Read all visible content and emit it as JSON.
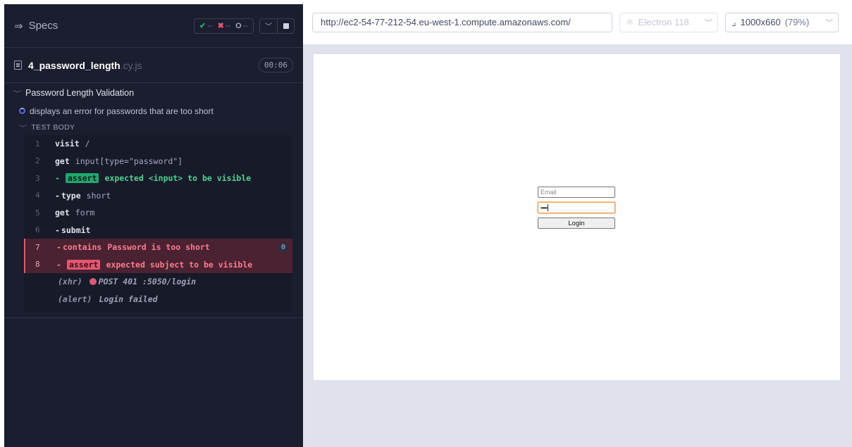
{
  "reporter": {
    "specs_label": "Specs",
    "stats": {
      "passed": "--",
      "failed": "--",
      "pending": "--"
    },
    "file": {
      "name": "4_password_length",
      "ext": ".cy.js",
      "duration": "00:06"
    },
    "suite_title": "Password Length Validation",
    "test_title": "displays an error for passwords that are too short",
    "body_header": "TEST BODY",
    "commands": [
      {
        "num": "1",
        "name": "visit",
        "arg": "/"
      },
      {
        "num": "2",
        "name": "get",
        "arg": "input[type=\"password\"]"
      },
      {
        "num": "3",
        "name": "assert",
        "arg": "expected <input> to be visible"
      },
      {
        "num": "4",
        "name": "type",
        "arg": "short"
      },
      {
        "num": "5",
        "name": "get",
        "arg": "form"
      },
      {
        "num": "6",
        "name": "submit",
        "arg": ""
      },
      {
        "num": "7",
        "name": "contains",
        "arg": "Password is too short",
        "count": "0"
      },
      {
        "num": "8",
        "name": "assert",
        "arg": "expected subject to be visible"
      }
    ],
    "logs": [
      {
        "type": "(xhr)",
        "text": "POST 401 :5050/login"
      },
      {
        "type": "(alert)",
        "text": "Login failed"
      }
    ]
  },
  "aut": {
    "url": "http://ec2-54-77-212-54.eu-west-1.compute.amazonaws.com/",
    "browser": "Electron 118",
    "viewport": "1000x660",
    "scale": "(79%)",
    "app": {
      "email_placeholder": "Email",
      "password_value": "•••••",
      "login_label": "Login"
    }
  },
  "colors": {
    "pass": "#1fa971",
    "fail": "#e45770",
    "reporter_bg": "#1b1e2e",
    "stage_bg": "#dfe2eb"
  }
}
